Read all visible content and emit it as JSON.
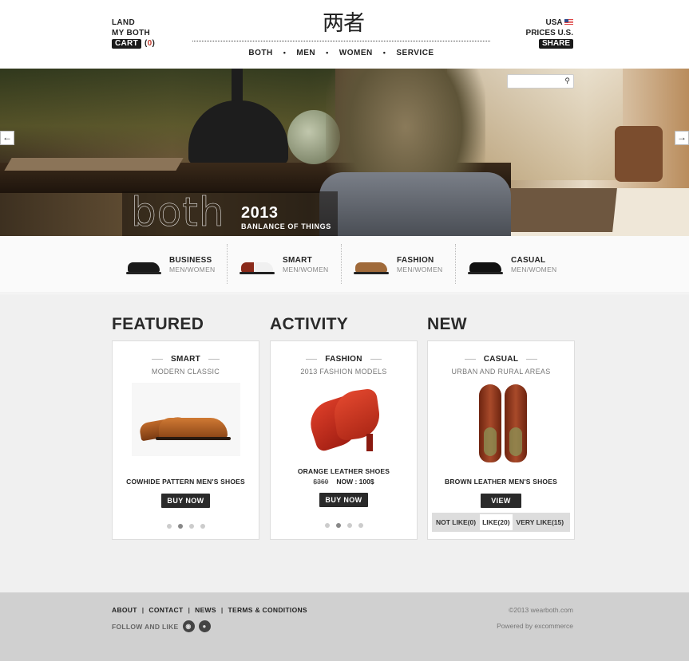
{
  "header": {
    "account_links": [
      "LAND",
      "MY BOTH"
    ],
    "cart_label": "CART",
    "cart_count_open": "(",
    "cart_count": "0",
    "cart_count_close": ")",
    "logo": "两者",
    "nav": [
      "BOTH",
      "MEN",
      "WOMEN",
      "SERVICE"
    ],
    "nav_separator": "•",
    "country": "USA",
    "prices": "PRICES  U.S.",
    "share_label": "SHARE"
  },
  "hero": {
    "brand_word": "both",
    "year": "2013",
    "tagline": "BANLANCE OF THINGS",
    "search_placeholder": "",
    "prev_arrow": "←",
    "next_arrow": "→",
    "search_icon": "magnifier-icon"
  },
  "categories": [
    {
      "title": "BUSINESS",
      "subtitle": "MEN/WOMEN",
      "color": "#1a1a1a"
    },
    {
      "title": "SMART",
      "subtitle": "MEN/WOMEN",
      "color": "#8a2a1a"
    },
    {
      "title": "FASHION",
      "subtitle": "MEN/WOMEN",
      "color": "#a06a3a"
    },
    {
      "title": "CASUAL",
      "subtitle": "MEN/WOMEN",
      "color": "#111111"
    }
  ],
  "sections": [
    {
      "heading": "FEATURED",
      "card_title": "SMART",
      "card_subtitle": "MODERN CLASSIC",
      "product": "COWHIDE PATTERN MEN'S SHOES",
      "button": "BUY NOW"
    },
    {
      "heading": "ACTIVITY",
      "card_title": "FASHION",
      "card_subtitle": "2013 FASHION MODELS",
      "product": "ORANGE LEATHER SHOES",
      "old_price": "$360",
      "now_price": "NOW : 100$",
      "button": "BUY NOW"
    },
    {
      "heading": "NEW",
      "card_title": "CASUAL",
      "card_subtitle": "URBAN AND RURAL AREAS",
      "product": "BROWN LEATHER MEN'S SHOES",
      "button": "VIEW",
      "reactions": [
        "NOT LIKE(0)",
        "LIKE(20)",
        "VERY LIKE(15)"
      ]
    }
  ],
  "footer": {
    "links": [
      "ABOUT",
      "CONTACT",
      "NEWS",
      "TERMS & CONDITIONS"
    ],
    "separator": "|",
    "follow_label": "FOLLOW AND LIKE",
    "copyright": "©2013 wearboth.com",
    "powered": "Powered by excommerce"
  }
}
